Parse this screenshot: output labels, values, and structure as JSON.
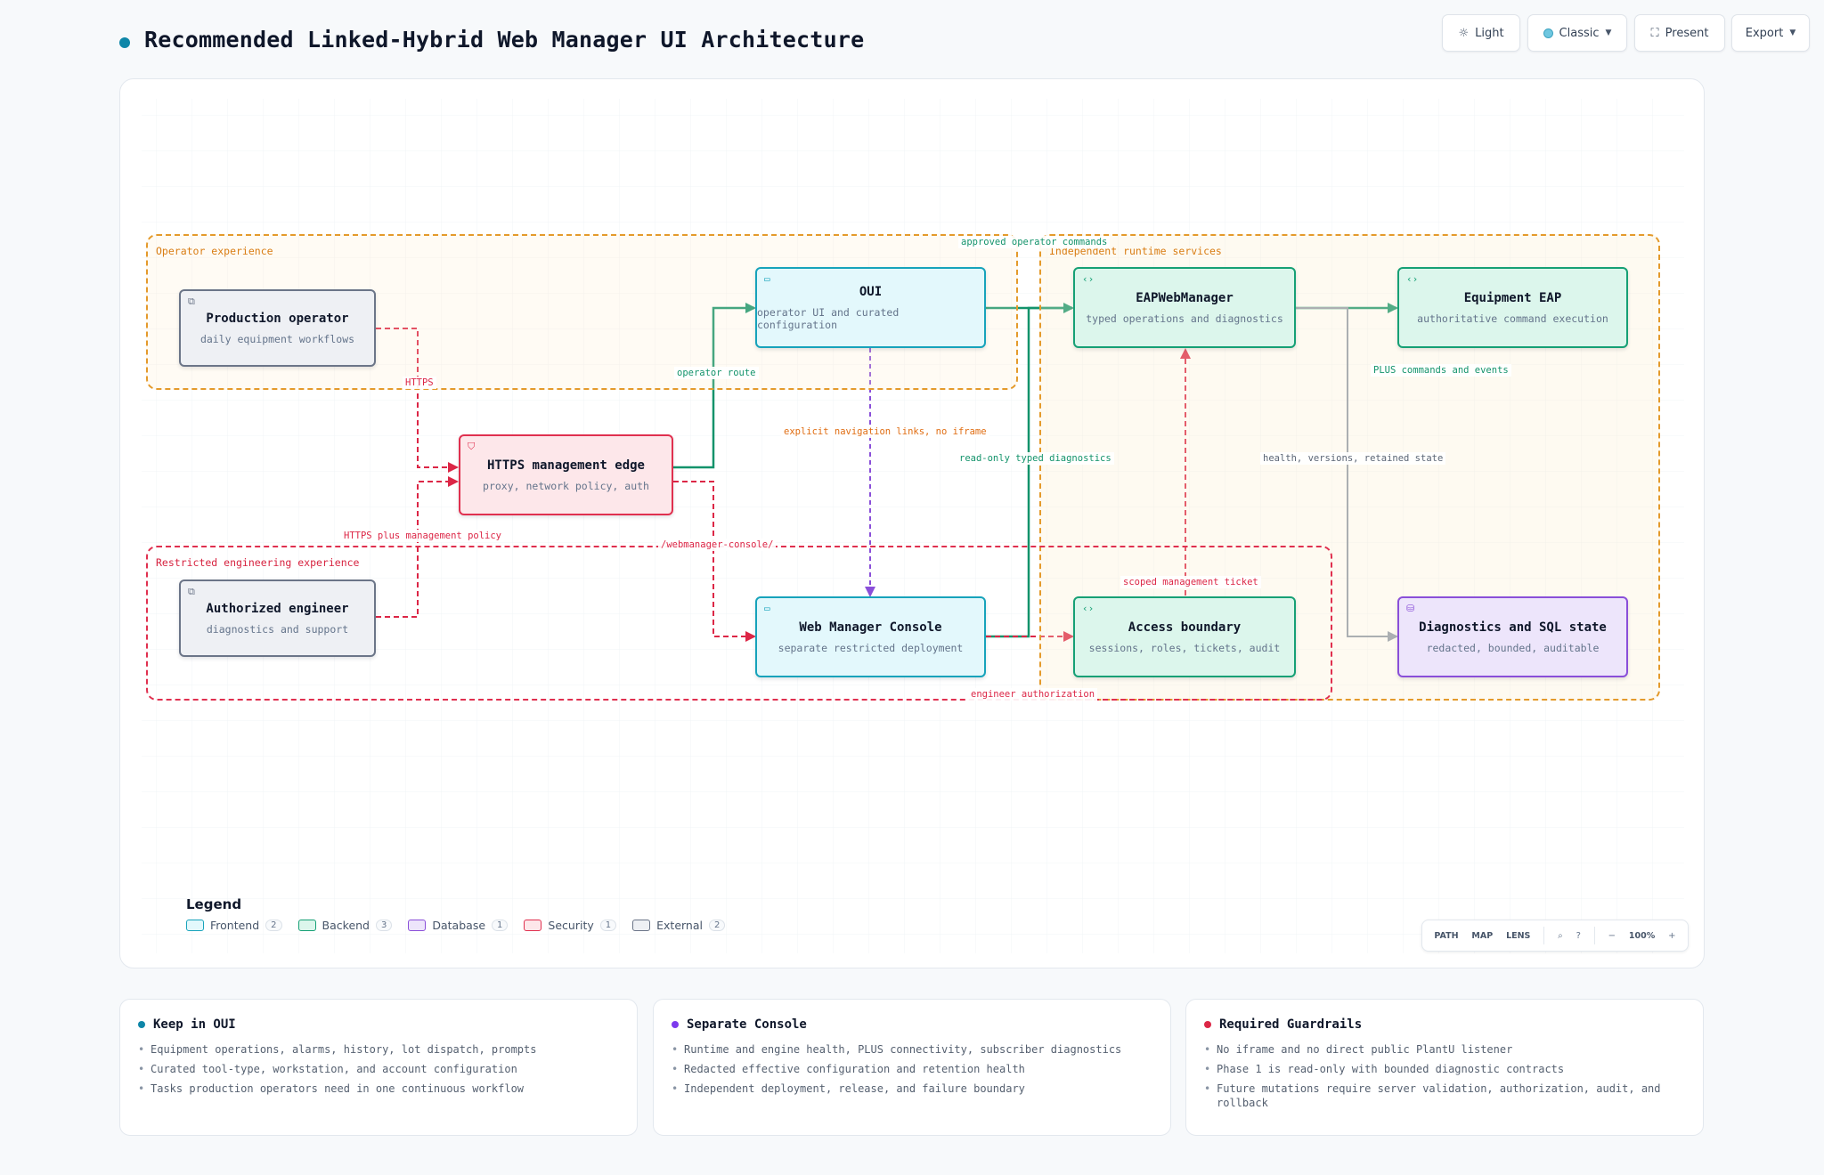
{
  "page": {
    "title": "Recommended Linked-Hybrid Web Manager UI Architecture"
  },
  "toolbar": {
    "light_label": "Light",
    "light_icon": "sun-icon",
    "theme_label": "Classic",
    "theme_icon": "palette-dot-icon",
    "present_label": "Present",
    "present_icon": "fullscreen-icon",
    "export_label": "Export"
  },
  "groups": {
    "operator": "Operator experience",
    "runtime": "Independent runtime services",
    "engineering": "Restricted engineering experience"
  },
  "nodes": {
    "production_operator": {
      "title": "Production operator",
      "sub": "daily equipment workflows",
      "kind": "external"
    },
    "authorized_engineer": {
      "title": "Authorized engineer",
      "sub": "diagnostics and support",
      "kind": "external"
    },
    "https_edge": {
      "title": "HTTPS management edge",
      "sub": "proxy, network policy, auth",
      "kind": "security"
    },
    "oui": {
      "title": "OUI",
      "sub": "operator UI and curated configuration",
      "kind": "frontend"
    },
    "web_console": {
      "title": "Web Manager Console",
      "sub": "separate restricted deployment",
      "kind": "frontend"
    },
    "eap_web_manager": {
      "title": "EAPWebManager",
      "sub": "typed operations and diagnostics",
      "kind": "backend"
    },
    "access_boundary": {
      "title": "Access boundary",
      "sub": "sessions, roles, tickets, audit",
      "kind": "backend"
    },
    "equipment_eap": {
      "title": "Equipment EAP",
      "sub": "authoritative command execution",
      "kind": "backend"
    },
    "diagnostics_sql": {
      "title": "Diagnostics and SQL state",
      "sub": "redacted, bounded, auditable",
      "kind": "database"
    }
  },
  "edges": {
    "https": "HTTPS",
    "https_policy": "HTTPS plus management policy",
    "operator_route": "operator route",
    "webmanager_console": "/webmanager-console/",
    "approved_commands": "approved operator commands",
    "explicit_links": "explicit navigation links, no iframe",
    "read_only": "read-only typed diagnostics",
    "plus_commands": "PLUS commands and events",
    "health_versions": "health, versions, retained state",
    "scoped_ticket": "scoped management ticket",
    "engineer_auth": "engineer authorization"
  },
  "colors": {
    "frontend": "#17a3bb",
    "backend": "#16a075",
    "database": "#8a4fd9",
    "security": "#e0304f",
    "external": "#6b7588",
    "operator_group": "#e49a2b",
    "engineering_group": "#e0304f"
  },
  "legend": {
    "title": "Legend",
    "items": [
      {
        "label": "Frontend",
        "count": "2"
      },
      {
        "label": "Backend",
        "count": "3"
      },
      {
        "label": "Database",
        "count": "1"
      },
      {
        "label": "Security",
        "count": "1"
      },
      {
        "label": "External",
        "count": "2"
      }
    ]
  },
  "zoom": {
    "path": "PATH",
    "map": "MAP",
    "lens": "LENS",
    "level": "100%",
    "minus": "−",
    "plus": "+"
  },
  "cards": [
    {
      "title": "Keep in OUI",
      "items": [
        "Equipment operations, alarms, history, lot dispatch, prompts",
        "Curated tool-type, workstation, and account configuration",
        "Tasks production operators need in one continuous workflow"
      ]
    },
    {
      "title": "Separate Console",
      "items": [
        "Runtime and engine health, PLUS connectivity, subscriber diagnostics",
        "Redacted effective configuration and retention health",
        "Independent deployment, release, and failure boundary"
      ]
    },
    {
      "title": "Required Guardrails",
      "items": [
        "No iframe and no direct public PlantU listener",
        "Phase 1 is read-only with bounded diagnostic contracts",
        "Future mutations require server validation, authorization, audit, and rollback"
      ]
    }
  ]
}
